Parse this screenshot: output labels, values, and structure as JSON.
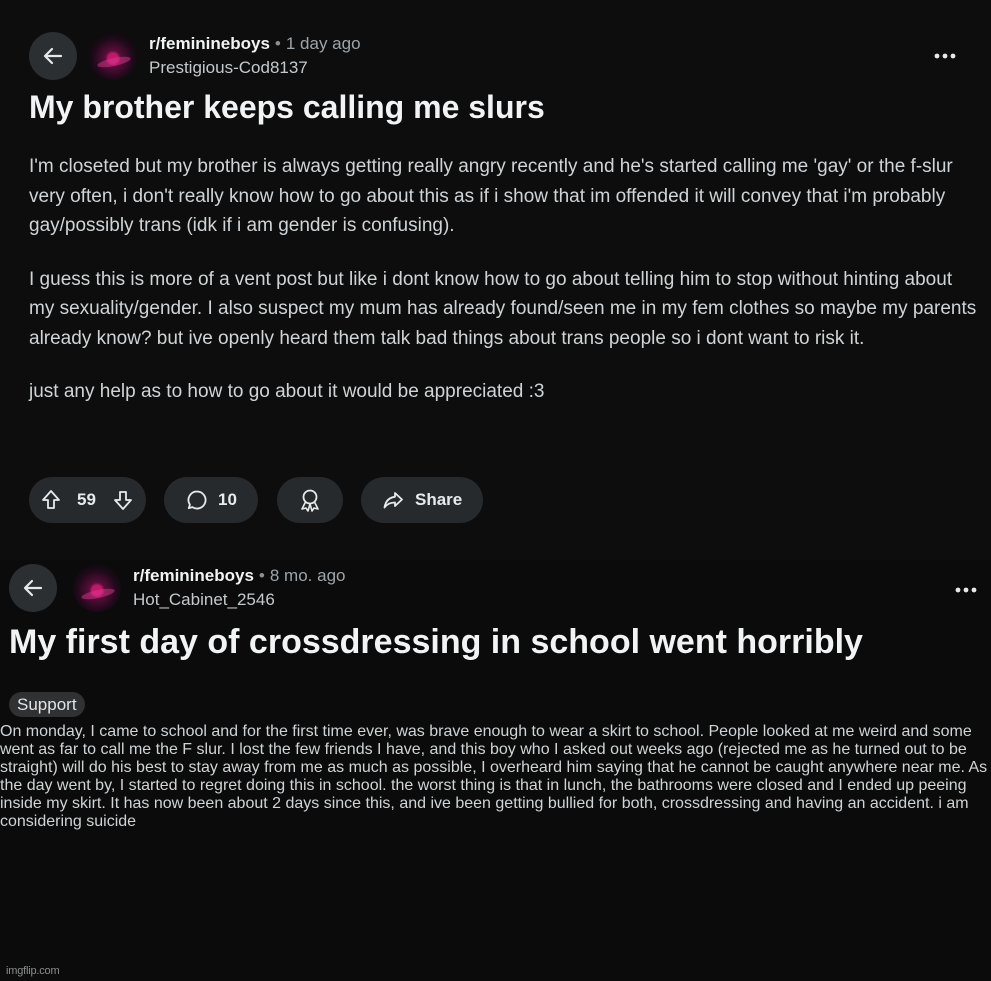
{
  "post1": {
    "subreddit": "r/feminineboys",
    "separator": "•",
    "age": "1 day ago",
    "author": "Prestigious-Cod8137",
    "title": "My brother keeps calling me slurs",
    "paragraphs": [
      "I'm closeted but my brother is always getting really angry recently and he's started calling me 'gay' or the f-slur very often, i don't really know how to go about this as if i show that im offended it will convey that i'm probably gay/possibly trans (idk if i am gender is confusing).",
      "I guess this is more of a vent post but like i dont know how to go about telling him to stop without hinting about my sexuality/gender. I also suspect my mum has already found/seen me in my fem clothes so maybe my parents already know? but ive openly heard them talk bad things about trans people so i dont want to risk it.",
      "just any help as to how to go about it would be appreciated :3"
    ],
    "votes": "59",
    "comments": "10",
    "share_label": "Share"
  },
  "post2": {
    "subreddit": "r/feminineboys",
    "separator": "•",
    "age": "8 mo. ago",
    "author": "Hot_Cabinet_2546",
    "title": "My first day of crossdressing in school went horribly",
    "flair": "Support",
    "body": "On monday, I came to school and for the first time ever, was brave enough to wear a skirt to school. People looked at me weird and some went as far to call me the F slur. I lost the few friends I have, and this boy who I asked out weeks ago (rejected me as he turned out to be straight) will do his best to stay away from me as much as possible, I overheard him saying that he cannot be caught anywhere near me. As the day went by, I started to regret doing this in school. the worst thing is that in lunch, the bathrooms were closed and I ended up peeing inside my skirt. It has now been about 2 days since this, and ive been getting bullied for both, crossdressing and having an accident. i am considering suicide"
  },
  "watermark": "imgflip.com",
  "icons": {
    "back": "arrow-left-icon",
    "more": "more-horizontal-icon",
    "upvote": "upvote-arrow-icon",
    "downvote": "downvote-arrow-icon",
    "comment": "comment-bubble-icon",
    "award": "award-ribbon-icon",
    "share": "share-arrow-icon"
  },
  "colors": {
    "background": "#0b0b0b",
    "pill": "#272a2c",
    "text": "#d7dadc"
  }
}
